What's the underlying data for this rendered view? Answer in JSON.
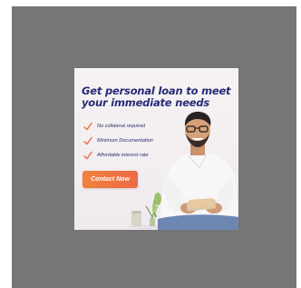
{
  "ad": {
    "headline": "Get personal loan to meet your immediate needs",
    "bullets": [
      "No collateral required",
      "Minimum Documentation",
      "Affordable interest rate"
    ],
    "cta_label": "Contact Now"
  },
  "colors": {
    "viewer_background": "#767676",
    "headline": "#262b78",
    "tick": "#ef6c3a",
    "cta": "#f0813b"
  },
  "icons": [
    "checkmark-icon"
  ]
}
